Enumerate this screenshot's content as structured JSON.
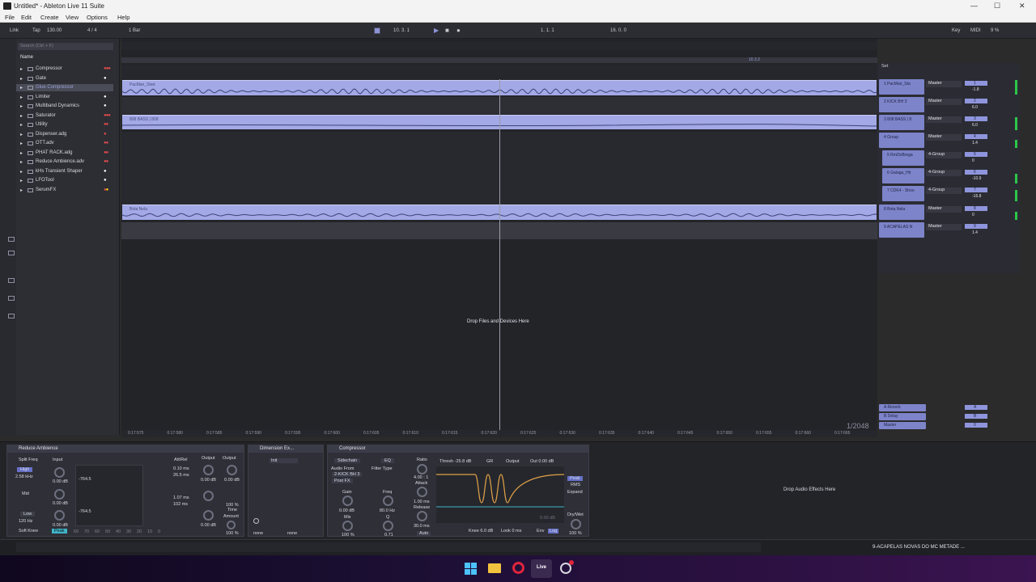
{
  "window": {
    "title": "Untitled* - Ableton Live 11 Suite",
    "minimize": "—",
    "maximize": "☐",
    "close": "✕"
  },
  "menu": [
    "File",
    "Edit",
    "Create",
    "View",
    "Options",
    "Help"
  ],
  "toolbar": {
    "link": "Link",
    "tap": "Tap",
    "tempo": "130.00",
    "sig": "4 / 4",
    "quant": "1 Bar",
    "position": "10. 3. 1",
    "loop_start": "1. 1. 1",
    "loop_len": "16. 0. 0",
    "key": "Key",
    "midi": "MIDI",
    "cpu": "9 %"
  },
  "browser": {
    "search_placeholder": "Search (Ctrl + F)",
    "column_header": "Name",
    "items": [
      {
        "label": "Compressor",
        "dots": [
          "#e24b4b",
          "#e24b4b",
          "#e24b4b"
        ]
      },
      {
        "label": "Gate",
        "dots": [
          "#ffffff"
        ]
      },
      {
        "label": "Glue Compressor",
        "dots": []
      },
      {
        "label": "Limiter",
        "dots": [
          "#ffffff"
        ]
      },
      {
        "label": "Multiband Dynamics",
        "dots": [
          "#ffffff"
        ]
      },
      {
        "label": "Saturator",
        "dots": [
          "#e24b4b",
          "#e24b4b",
          "#e24b4b"
        ]
      },
      {
        "label": "Utility",
        "dots": [
          "#e24b4b",
          "#e24b4b"
        ]
      },
      {
        "label": "Dispenser.adg",
        "dots": [
          "#e24b4b"
        ]
      },
      {
        "label": "OTT.adv",
        "dots": [
          "#e24b4b",
          "#e24b4b"
        ]
      },
      {
        "label": "PHAT RACK.adg",
        "dots": [
          "#e24b4b",
          "#e24b4b"
        ]
      },
      {
        "label": "Reduce Ambience.adv",
        "dots": [
          "#e24b4b",
          "#e24b4b"
        ]
      },
      {
        "label": "kHs Transient Shaper",
        "dots": [
          "#ffffff"
        ]
      },
      {
        "label": "LFOTool",
        "dots": [
          "#ffffff"
        ]
      },
      {
        "label": "SerumFX",
        "dots": [
          "#e24b4b",
          "#ffd400"
        ]
      }
    ]
  },
  "arrangement": {
    "loop_marker": "10.3.2",
    "drop_hint": "Drop Files and Devices Here",
    "zoom": "1/2048",
    "clips": [
      "PacMan_Start",
      "808 BASS | 808",
      "Bota Nela"
    ],
    "timeline": [
      "0:17:575",
      "0:17:580",
      "0:17:585",
      "0:17:590",
      "0:17:595",
      "0:17:600",
      "0:17:605",
      "0:17:610",
      "0:17:615",
      "0:17:620",
      "0:17:625",
      "0:17:630",
      "0:17:635",
      "0:17:640",
      "0:17:645",
      "0:17:650",
      "0:17:655",
      "0:17:660",
      "0:17:665"
    ]
  },
  "mixer": {
    "set_label": "Set",
    "tracks": [
      {
        "name": "1 PacMan_Sta",
        "io": "Master",
        "vol": "-1.8",
        "num": "1"
      },
      {
        "name": "2 KICK BH 3",
        "io": "Master",
        "vol": "6.0",
        "num": "2"
      },
      {
        "name": "3 808 BASS | 8",
        "io": "Master",
        "vol": "6.0",
        "num": "3"
      },
      {
        "name": "4 Group",
        "io": "Master",
        "vol": "1.4",
        "num": "4"
      },
      {
        "name": "5 RmDoBrega",
        "io": "4-Group",
        "vol": "0",
        "num": "5"
      },
      {
        "name": "6 Galaga_Hit",
        "io": "4-Group",
        "vol": "-10.9",
        "num": "6"
      },
      {
        "name": "7 CDK4 - Shoo",
        "io": "4-Group",
        "vol": "-16.8",
        "num": "7"
      },
      {
        "name": "8 Bota Nela",
        "io": "Master",
        "vol": "0",
        "num": "8"
      },
      {
        "name": "9 ACAPELAS N",
        "io": "Master",
        "vol": "1.4",
        "num": "9"
      }
    ],
    "returns": [
      {
        "name": "A Reverb",
        "letter": "A"
      },
      {
        "name": "B Delay",
        "letter": "B"
      },
      {
        "name": "Master",
        "letter": "0"
      }
    ]
  },
  "devices": {
    "reduce": {
      "title": "Reduce Ambience",
      "split": "Split Freq",
      "input": "Input",
      "high": "High",
      "freq1": "2.58 kHz",
      "mid": "Mid",
      "low": "Low",
      "freq2": "120 Hz",
      "soft": "Soft Knee",
      "peak": "Peak",
      "db1": "0.00 dB",
      "db2": "0.00 dB",
      "db3": "0.00 dB",
      "g1": "-764.5",
      "g2": "-764.5",
      "attrel": "Att/Rel",
      "output": "Output",
      "a1": "0.10 ms",
      "r1": "26.5 ms",
      "a2": "1.07 ms",
      "r2": "102 ms",
      "o1": "0.00 dB",
      "o2": "0.00 dB",
      "o3": "0.00 dB",
      "pct": "100 %",
      "time": "Time",
      "amount": "Amount",
      "pct2": "100 %",
      "scale": [
        "60",
        "70",
        "60",
        "50",
        "40",
        "30",
        "20",
        "10",
        "0"
      ]
    },
    "dimension": {
      "title": "Dimension Ex...",
      "preset": "Init",
      "none1": "none",
      "none2": "none"
    },
    "compressor": {
      "title": "Compressor",
      "sidechain": "Sidechain",
      "eq": "EQ",
      "audio_from": "Audio From",
      "src": "2-KICK BH 3",
      "postfx": "Post FX",
      "filter": "Filter Type",
      "gain": "Gain",
      "gainval": "0.00 dB",
      "freq": "Freq",
      "freqval": "80.0 Hz",
      "mix": "Mix",
      "mixval": "100 %",
      "q": "Q",
      "qval": "0.71",
      "ratio": "Ratio",
      "ratioval": "4.00 : 1",
      "attack": "Attack",
      "attackval": "1.00 ms",
      "release": "Release",
      "releaseval": "30.0 ms",
      "auto": "Auto",
      "thresh": "Thresh -25.8 dB",
      "gr": "GR",
      "out": "Output",
      "outval": "Out 0.00 dB",
      "peak": "Peak",
      "rms": "RMS",
      "expand": "Expand",
      "knee": "Knee 6.0 dB",
      "look": "Look 0 ms",
      "env": "Env",
      "log": "Log",
      "drywet": "Dry/Wet",
      "drywetval": "100 %",
      "grdb": "0.00 dB"
    },
    "drop_hint": "Drop Audio Effects Here"
  },
  "status": {
    "right": "9-ACAPELAS NOVAS DO MC METADE ..."
  },
  "taskbar": {
    "live": "Live"
  }
}
